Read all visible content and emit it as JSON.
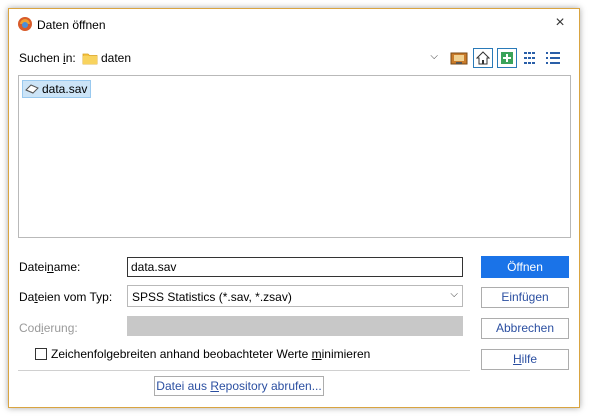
{
  "window": {
    "title": "Daten öffnen",
    "close": "×"
  },
  "lookin": {
    "label_pre": "Suchen ",
    "label_accel": "i",
    "label_post": "n:",
    "folder": "daten"
  },
  "files": [
    {
      "name": "data.sav",
      "selected": true
    }
  ],
  "form": {
    "filename_label_pre": "Datei",
    "filename_label_accel": "n",
    "filename_label_post": "ame:",
    "filename_value": "data.sav",
    "filetype_label_pre": "Da",
    "filetype_label_accel": "t",
    "filetype_label_post": "eien vom Typ:",
    "filetype_value": "SPSS Statistics (*.sav, *.zsav)",
    "encoding_label_pre": "Cod",
    "encoding_label_accel": "i",
    "encoding_label_post": "erung:",
    "checkbox_pre": "Zeichenfolgebreiten anhand beobachteter Werte ",
    "checkbox_accel": "m",
    "checkbox_post": "inimieren",
    "checkbox_checked": false
  },
  "buttons": {
    "open": "Öffnen",
    "insert": "Einfügen",
    "cancel": "Abbrechen",
    "help_accel": "H",
    "help_post": "ilfe",
    "repo_pre": "Datei aus ",
    "repo_accel": "R",
    "repo_post": "epository abrufen..."
  },
  "icons": {
    "app": "spss-open-icon",
    "folder": "folder-icon",
    "file": "spss-file-icon",
    "toolbar": [
      "network-folder-icon",
      "home-icon",
      "new-folder-icon",
      "list-view-icon",
      "details-view-icon"
    ]
  },
  "colors": {
    "primary": "#1a73e8",
    "selection": "#cce4f7",
    "link": "#2b4fa1"
  }
}
